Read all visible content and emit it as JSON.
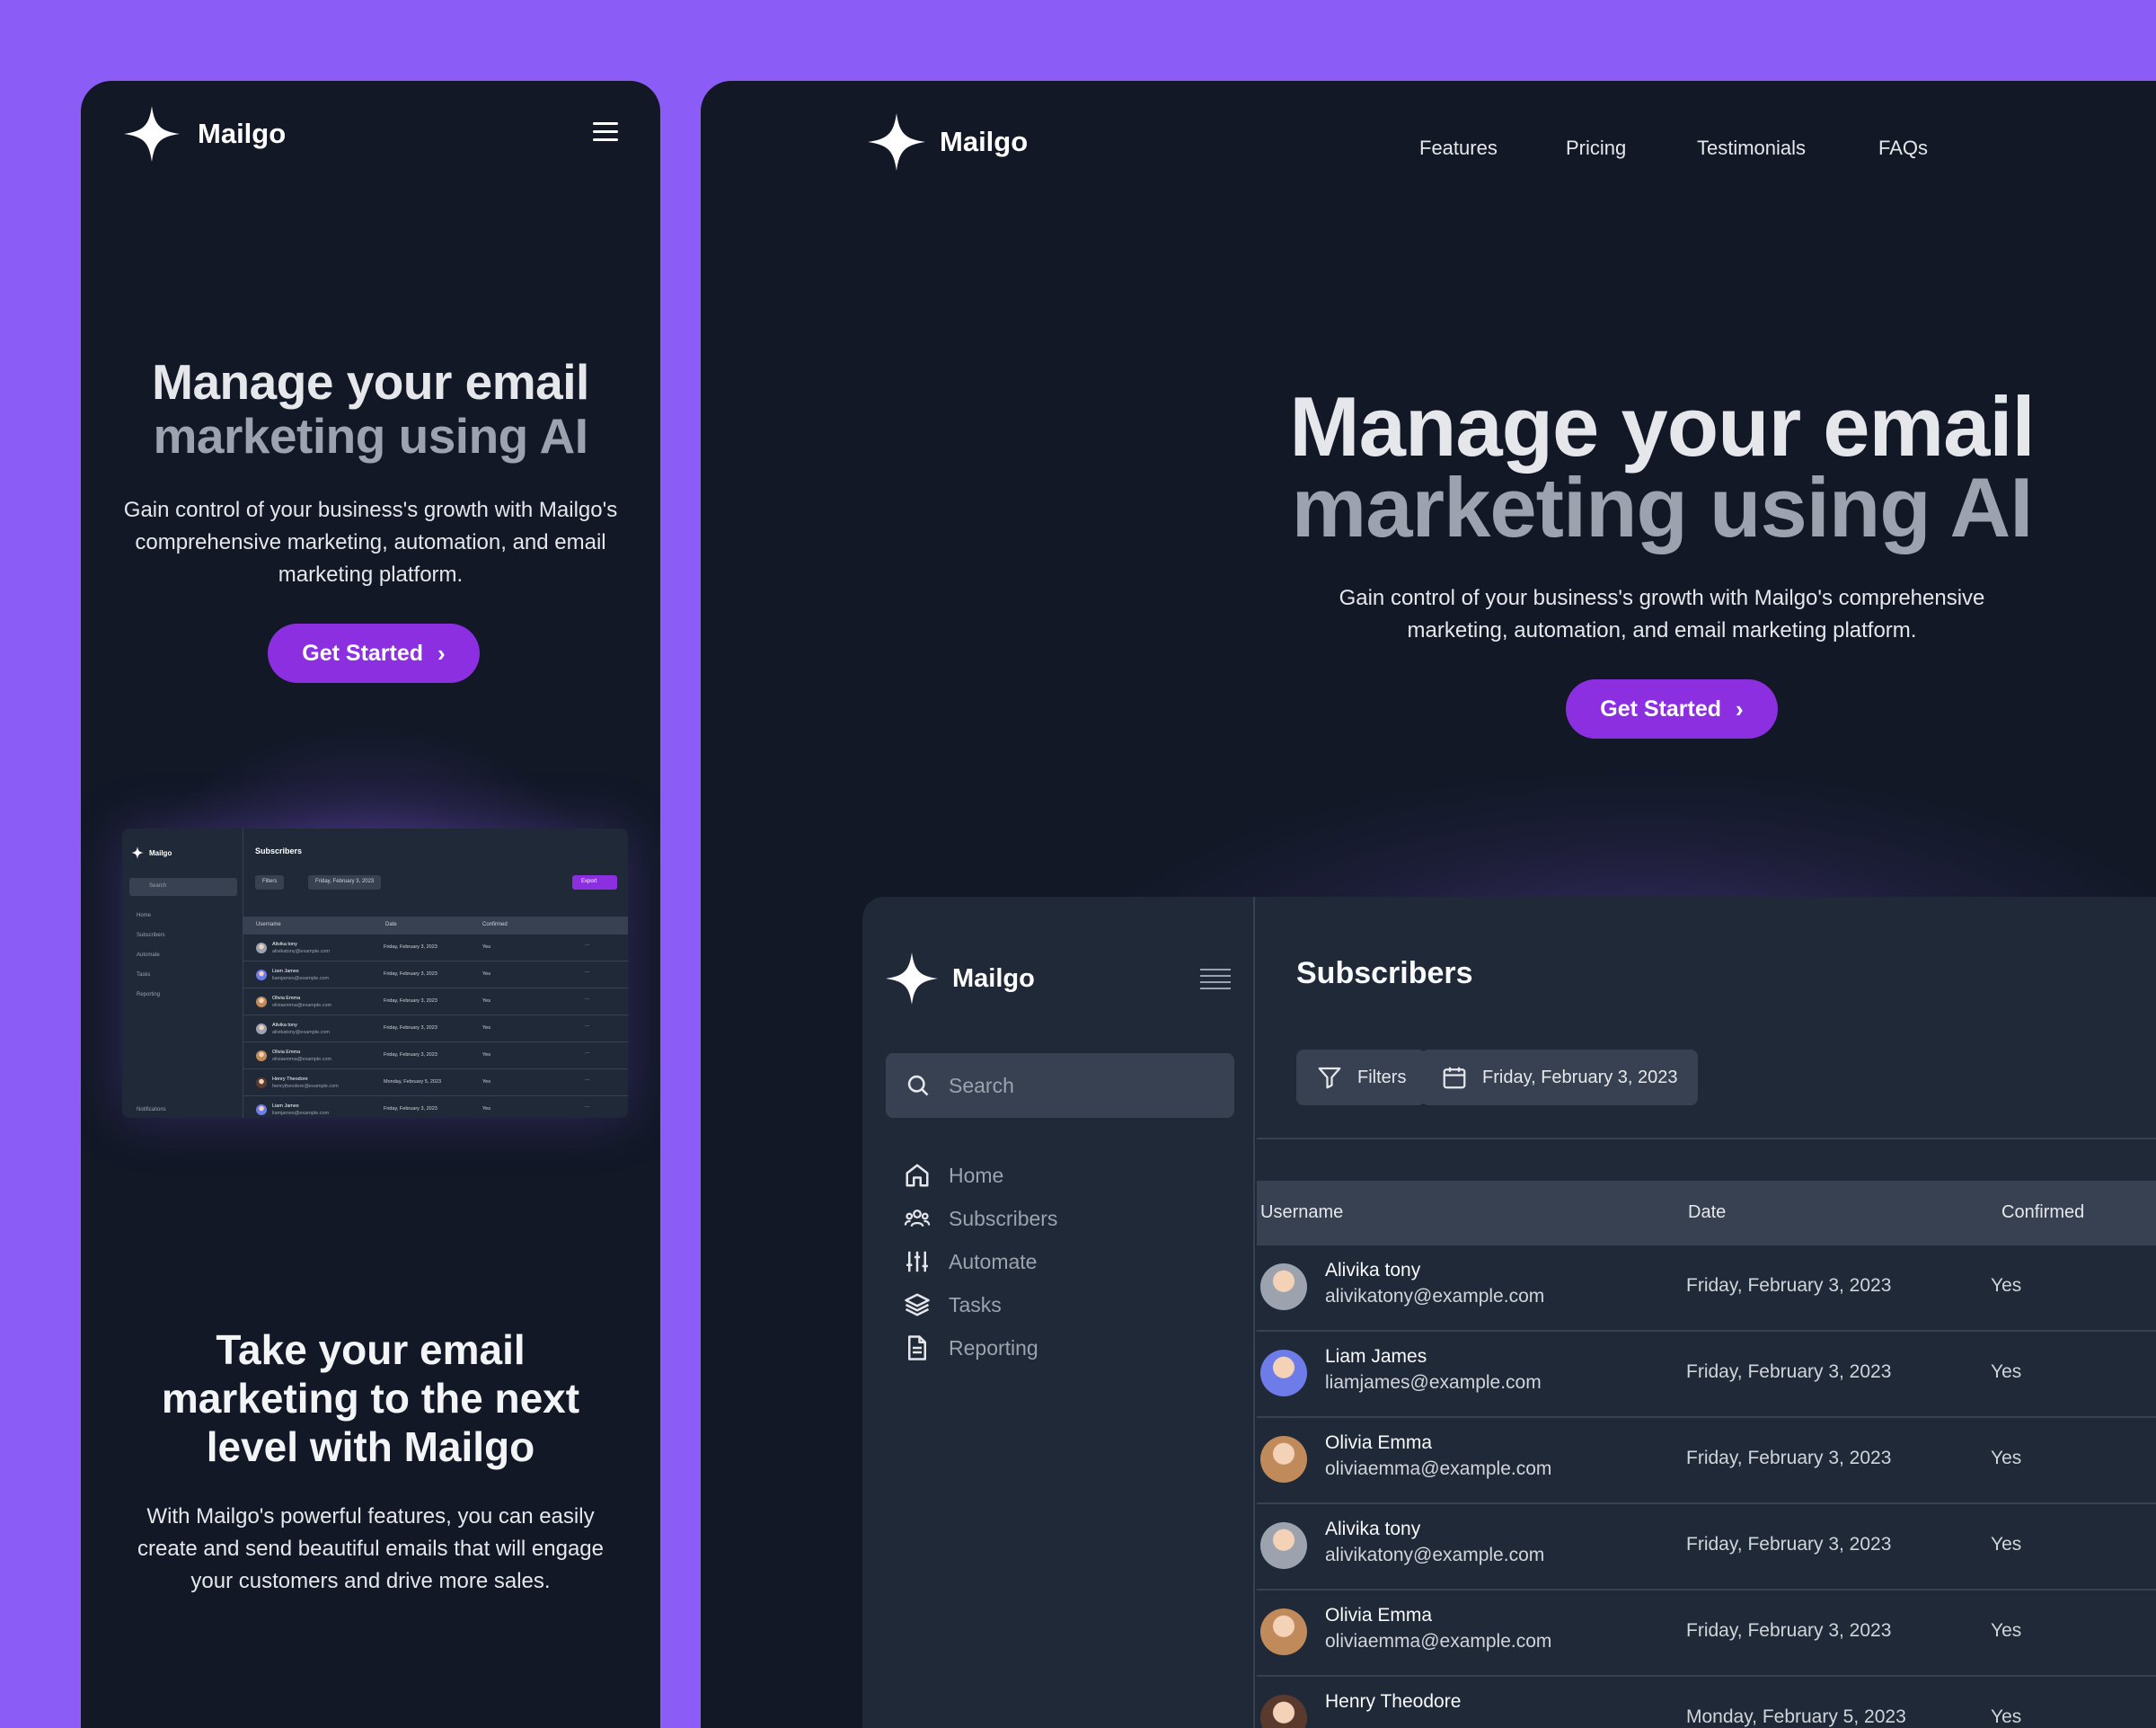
{
  "brand": {
    "name": "Mailgo"
  },
  "mobile": {
    "hero": {
      "title_line1": "Manage your email",
      "title_line2": "marketing using AI",
      "subtitle": "Gain control of your business's growth with Mailgo's comprehensive marketing, automation, and email marketing platform.",
      "cta": "Get Started"
    },
    "preview": {
      "title": "Subscribers",
      "search": "Search",
      "nav": [
        "Home",
        "Subscribers",
        "Automate",
        "Tasks",
        "Reporting"
      ],
      "filters": "Filters",
      "date_filter": "Friday, February 3, 2023",
      "export": "Export",
      "columns": [
        "Username",
        "Date",
        "Confirmed"
      ],
      "rows": [
        {
          "name": "Alivika tony",
          "email": "alivikatony@example.com",
          "date": "Friday, February 3, 2023",
          "confirmed": "Yes"
        },
        {
          "name": "Liam James",
          "email": "liamjames@example.com",
          "date": "Friday, February 3, 2023",
          "confirmed": "Yes"
        },
        {
          "name": "Olivia Emma",
          "email": "oliviaemma@example.com",
          "date": "Friday, February 3, 2023",
          "confirmed": "Yes"
        },
        {
          "name": "Alivika tony",
          "email": "alivikatony@example.com",
          "date": "Friday, February 3, 2023",
          "confirmed": "Yes"
        },
        {
          "name": "Olivia Emma",
          "email": "oliviaemma@example.com",
          "date": "Friday, February 3, 2023",
          "confirmed": "Yes"
        },
        {
          "name": "Henry Theodore",
          "email": "henrytheodore@example.com",
          "date": "Monday, February 5, 2023",
          "confirmed": "Yes"
        },
        {
          "name": "Liam James",
          "email": "liamjames@example.com",
          "date": "Friday, February 3, 2023",
          "confirmed": "Yes"
        }
      ],
      "more": "···",
      "notifications": "Notifications"
    },
    "section": {
      "title": "Take your email marketing to the next level with Mailgo",
      "subtitle": "With Mailgo's powerful features, you can easily create and send beautiful emails that will engage your customers and drive more sales."
    }
  },
  "desktop": {
    "nav": [
      "Features",
      "Pricing",
      "Testimonials",
      "FAQs"
    ],
    "hero": {
      "title_line1": "Manage your email",
      "title_line2": "marketing using AI",
      "subtitle": "Gain control of your business's growth with Mailgo's comprehensive marketing, automation, and email marketing platform.",
      "cta": "Get Started"
    },
    "app": {
      "brand": "Mailgo",
      "search_placeholder": "Search",
      "nav": [
        "Home",
        "Subscribers",
        "Automate",
        "Tasks",
        "Reporting"
      ],
      "page_title": "Subscribers",
      "filters_label": "Filters",
      "date_label": "Friday, February 3, 2023",
      "columns": [
        "Username",
        "Date",
        "Confirmed"
      ],
      "rows": [
        {
          "name": "Alivika tony",
          "email": "alivikatony@example.com",
          "date": "Friday, February 3, 2023",
          "confirmed": "Yes"
        },
        {
          "name": "Liam James",
          "email": "liamjames@example.com",
          "date": "Friday, February 3, 2023",
          "confirmed": "Yes"
        },
        {
          "name": "Olivia Emma",
          "email": "oliviaemma@example.com",
          "date": "Friday, February 3, 2023",
          "confirmed": "Yes"
        },
        {
          "name": "Alivika tony",
          "email": "alivikatony@example.com",
          "date": "Friday, February 3, 2023",
          "confirmed": "Yes"
        },
        {
          "name": "Olivia Emma",
          "email": "oliviaemma@example.com",
          "date": "Friday, February 3, 2023",
          "confirmed": "Yes"
        },
        {
          "name": "Henry Theodore",
          "email": "",
          "date": "Monday, February 5, 2023",
          "confirmed": "Yes"
        }
      ]
    }
  },
  "colors": {
    "page_bg": "#8b5cf6",
    "panel_bg": "#121826",
    "app_bg": "#1f2937",
    "accent": "#8b2fe0"
  }
}
